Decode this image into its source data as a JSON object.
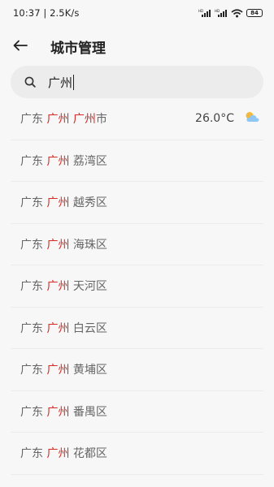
{
  "status_bar": {
    "time_speed": "10:37 | 2.5K/s",
    "battery": "84",
    "icons": [
      "signal-hd-icon",
      "signal-hd-icon",
      "wifi-icon",
      "battery-icon"
    ]
  },
  "header": {
    "title": "城市管理",
    "back_icon": "arrow-left-icon"
  },
  "search": {
    "value": "广州",
    "icon": "search-icon"
  },
  "results": [
    {
      "province": "广东",
      "match": "广州",
      "city_match": "广州",
      "suffix": "市",
      "temp": "26.0°C",
      "weather_icon": "partly-cloudy-icon"
    },
    {
      "province": "广东",
      "match": "广州",
      "district": "荔湾区"
    },
    {
      "province": "广东",
      "match": "广州",
      "district": "越秀区"
    },
    {
      "province": "广东",
      "match": "广州",
      "district": "海珠区"
    },
    {
      "province": "广东",
      "match": "广州",
      "district": "天河区"
    },
    {
      "province": "广东",
      "match": "广州",
      "district": "白云区"
    },
    {
      "province": "广东",
      "match": "广州",
      "district": "黄埔区"
    },
    {
      "province": "广东",
      "match": "广州",
      "district": "番禺区"
    },
    {
      "province": "广东",
      "match": "广州",
      "district": "花都区"
    }
  ],
  "colors": {
    "highlight": "#d62a24",
    "background": "#f7f7f7",
    "search_bg": "#ececec"
  }
}
